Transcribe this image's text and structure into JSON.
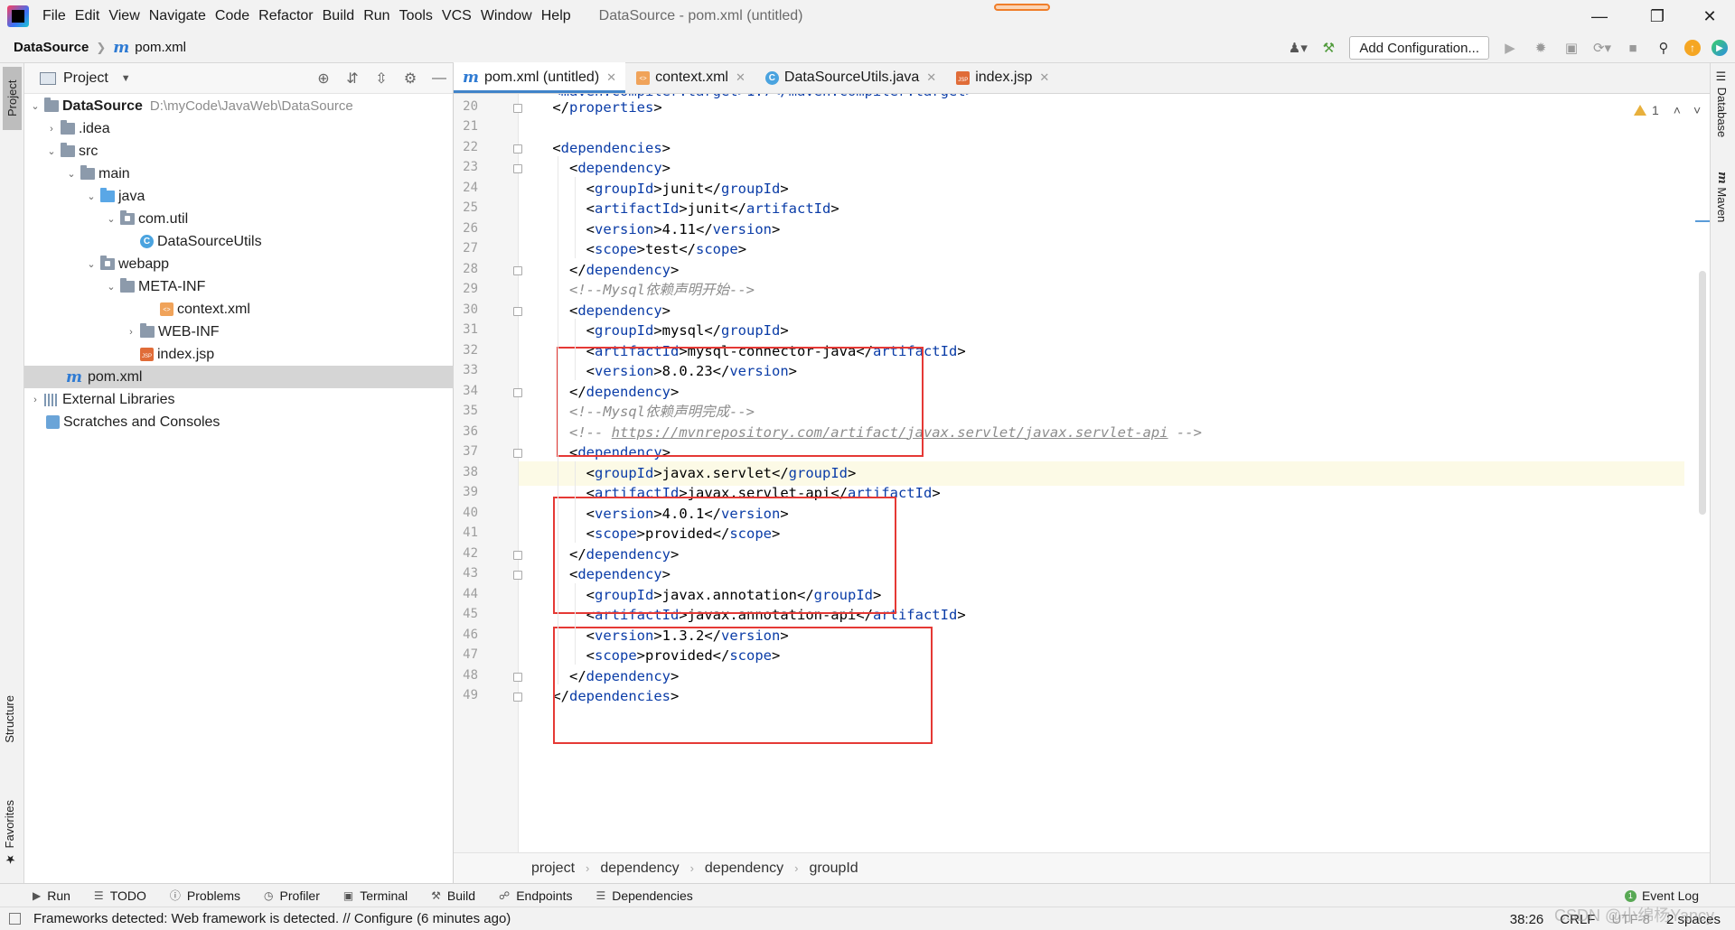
{
  "menubar": {
    "items": [
      "File",
      "Edit",
      "View",
      "Navigate",
      "Code",
      "Refactor",
      "Build",
      "Run",
      "Tools",
      "VCS",
      "Window",
      "Help"
    ],
    "window_title": "DataSource - pom.xml (untitled)"
  },
  "navbar": {
    "project": "DataSource",
    "file": "pom.xml",
    "add_configuration": "Add Configuration..."
  },
  "left_stripe": {
    "project": "Project",
    "structure": "Structure",
    "favorites": "Favorites"
  },
  "right_stripe": {
    "database": "Database",
    "maven": "Maven"
  },
  "project_panel": {
    "title": "Project",
    "tree": [
      {
        "label": "DataSource",
        "path": "D:\\myCode\\JavaWeb\\DataSource"
      },
      {
        "label": ".idea"
      },
      {
        "label": "src"
      },
      {
        "label": "main"
      },
      {
        "label": "java"
      },
      {
        "label": "com.util"
      },
      {
        "label": "DataSourceUtils"
      },
      {
        "label": "webapp"
      },
      {
        "label": "META-INF"
      },
      {
        "label": "context.xml"
      },
      {
        "label": "WEB-INF"
      },
      {
        "label": "index.jsp"
      },
      {
        "label": "pom.xml"
      },
      {
        "label": "External Libraries"
      },
      {
        "label": "Scratches and Consoles"
      }
    ]
  },
  "editor": {
    "tabs": [
      "pom.xml (untitled)",
      "context.xml",
      "DataSourceUtils.java",
      "index.jsp"
    ],
    "warning_count": "1",
    "line_numbers": [
      "20",
      "21",
      "22",
      "23",
      "24",
      "25",
      "26",
      "27",
      "28",
      "29",
      "30",
      "31",
      "32",
      "33",
      "34",
      "35",
      "36",
      "37",
      "38",
      "39",
      "40",
      "41",
      "42",
      "43",
      "44",
      "45",
      "46",
      "47",
      "48",
      "49"
    ],
    "top_partial_line": "    <maven.compiler.target>1.7</maven.compiler.target>",
    "lines": [
      {
        "indent": "    ",
        "open": "</",
        "tag": "properties",
        "close": ">",
        "text": "",
        "open2": "",
        "tag2": "",
        "close2": ""
      },
      {
        "indent": "",
        "open": "",
        "tag": "",
        "close": "",
        "text": "",
        "open2": "",
        "tag2": "",
        "close2": ""
      },
      {
        "indent": "    ",
        "open": "<",
        "tag": "dependencies",
        "close": ">",
        "text": "",
        "open2": "",
        "tag2": "",
        "close2": ""
      },
      {
        "indent": "      ",
        "open": "<",
        "tag": "dependency",
        "close": ">",
        "text": "",
        "open2": "",
        "tag2": "",
        "close2": ""
      },
      {
        "indent": "        ",
        "open": "<",
        "tag": "groupId",
        "close": ">",
        "text": "junit",
        "open2": "</",
        "tag2": "groupId",
        "close2": ">"
      },
      {
        "indent": "        ",
        "open": "<",
        "tag": "artifactId",
        "close": ">",
        "text": "junit",
        "open2": "</",
        "tag2": "artifactId",
        "close2": ">"
      },
      {
        "indent": "        ",
        "open": "<",
        "tag": "version",
        "close": ">",
        "text": "4.11",
        "open2": "</",
        "tag2": "version",
        "close2": ">"
      },
      {
        "indent": "        ",
        "open": "<",
        "tag": "scope",
        "close": ">",
        "text": "test",
        "open2": "</",
        "tag2": "scope",
        "close2": ">"
      },
      {
        "indent": "      ",
        "open": "</",
        "tag": "dependency",
        "close": ">",
        "text": "",
        "open2": "",
        "tag2": "",
        "close2": ""
      },
      {
        "indent": "      ",
        "comment": "<!--Mysql依赖声明开始-->"
      },
      {
        "indent": "      ",
        "open": "<",
        "tag": "dependency",
        "close": ">",
        "text": "",
        "open2": "",
        "tag2": "",
        "close2": ""
      },
      {
        "indent": "        ",
        "open": "<",
        "tag": "groupId",
        "close": ">",
        "text": "mysql",
        "open2": "</",
        "tag2": "groupId",
        "close2": ">"
      },
      {
        "indent": "        ",
        "open": "<",
        "tag": "artifactId",
        "close": ">",
        "text": "mysql-connector-java",
        "open2": "</",
        "tag2": "artifactId",
        "close2": ">"
      },
      {
        "indent": "        ",
        "open": "<",
        "tag": "version",
        "close": ">",
        "text": "8.0.23",
        "open2": "</",
        "tag2": "version",
        "close2": ">"
      },
      {
        "indent": "      ",
        "open": "</",
        "tag": "dependency",
        "close": ">",
        "text": "",
        "open2": "",
        "tag2": "",
        "close2": ""
      },
      {
        "indent": "      ",
        "comment": "<!--Mysql依赖声明完成-->"
      },
      {
        "indent": "      ",
        "comment": "<!-- ",
        "url": "https://mvnrepository.com/artifact/javax.servlet/javax.servlet-api",
        "comment_end": " -->"
      },
      {
        "indent": "      ",
        "open": "<",
        "tag": "dependency",
        "close": ">",
        "text": "",
        "open2": "",
        "tag2": "",
        "close2": ""
      },
      {
        "indent": "        ",
        "open": "<",
        "tag": "groupId",
        "close": ">",
        "text": "javax.servlet",
        "open2": "</",
        "tag2": "groupId",
        "close2": ">"
      },
      {
        "indent": "        ",
        "open": "<",
        "tag": "artifactId",
        "close": ">",
        "text": "javax.servlet-api",
        "open2": "</",
        "tag2": "artifactId",
        "close2": ">"
      },
      {
        "indent": "        ",
        "open": "<",
        "tag": "version",
        "close": ">",
        "text": "4.0.1",
        "open2": "</",
        "tag2": "version",
        "close2": ">"
      },
      {
        "indent": "        ",
        "open": "<",
        "tag": "scope",
        "close": ">",
        "text": "provided",
        "open2": "</",
        "tag2": "scope",
        "close2": ">"
      },
      {
        "indent": "      ",
        "open": "</",
        "tag": "dependency",
        "close": ">",
        "text": "",
        "open2": "",
        "tag2": "",
        "close2": ""
      },
      {
        "indent": "      ",
        "open": "<",
        "tag": "dependency",
        "close": ">",
        "text": "",
        "open2": "",
        "tag2": "",
        "close2": ""
      },
      {
        "indent": "        ",
        "open": "<",
        "tag": "groupId",
        "close": ">",
        "text": "javax.annotation",
        "open2": "</",
        "tag2": "groupId",
        "close2": ">"
      },
      {
        "indent": "        ",
        "open": "<",
        "tag": "artifactId",
        "close": ">",
        "text": "javax.annotation-api",
        "open2": "</",
        "tag2": "artifactId",
        "close2": ">"
      },
      {
        "indent": "        ",
        "open": "<",
        "tag": "version",
        "close": ">",
        "text": "1.3.2",
        "open2": "</",
        "tag2": "version",
        "close2": ">"
      },
      {
        "indent": "        ",
        "open": "<",
        "tag": "scope",
        "close": ">",
        "text": "provided",
        "open2": "</",
        "tag2": "scope",
        "close2": ">"
      },
      {
        "indent": "      ",
        "open": "</",
        "tag": "dependency",
        "close": ">",
        "text": "",
        "open2": "",
        "tag2": "",
        "close2": ""
      },
      {
        "indent": "    ",
        "open": "</",
        "tag": "dependencies",
        "close": ">",
        "text": "",
        "open2": "",
        "tag2": "",
        "close2": ""
      }
    ],
    "breadcrumbs": [
      "project",
      "dependency",
      "dependency",
      "groupId"
    ]
  },
  "bottom_tools": [
    "Run",
    "TODO",
    "Problems",
    "Profiler",
    "Terminal",
    "Build",
    "Endpoints",
    "Dependencies"
  ],
  "event_log": "Event Log",
  "status": {
    "message": "Frameworks detected: Web framework is detected. // Configure (6 minutes ago)",
    "position": "38:26",
    "line_separator": "CRLF",
    "encoding": "UTF-8",
    "indent": "2 spaces"
  },
  "watermark": "CSDN @小绵杨Yancy",
  "colors": {
    "tag": "#0a3ca7",
    "comment": "#8c8c8c",
    "highlight_box": "#e53935",
    "current_line": "#fcfae6"
  }
}
